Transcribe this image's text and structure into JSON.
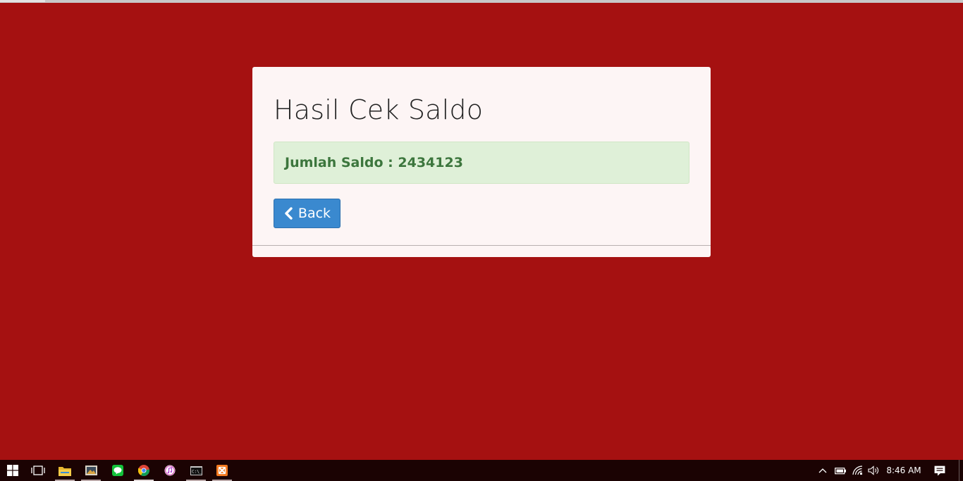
{
  "page": {
    "background_color": "#a51111"
  },
  "card": {
    "title": "Hasil Cek Saldo",
    "alert": {
      "label": "Jumlah Saldo",
      "separator": " : ",
      "value": "2434123",
      "color": "#3c763d",
      "background": "#dff0d8"
    },
    "back_button": {
      "label": "Back",
      "icon": "chevron-left-icon",
      "color": "#3a89cf"
    }
  },
  "taskbar": {
    "pinned": [
      {
        "name": "start-button",
        "icon": "windows-logo-icon"
      },
      {
        "name": "task-view-button",
        "icon": "task-view-icon"
      },
      {
        "name": "file-explorer",
        "icon": "folder-icon",
        "running": true
      },
      {
        "name": "image-viewer",
        "icon": "picture-icon",
        "running": true
      },
      {
        "name": "line-messenger",
        "icon": "chat-bubble-icon"
      },
      {
        "name": "chrome-browser",
        "icon": "chrome-icon",
        "running": true,
        "active": true
      },
      {
        "name": "itunes",
        "icon": "music-note-icon"
      },
      {
        "name": "command-prompt",
        "icon": "terminal-icon",
        "running": true
      },
      {
        "name": "xampp",
        "icon": "xampp-icon",
        "running": true
      }
    ],
    "tray": {
      "icons": [
        "chevron-up-icon",
        "battery-icon",
        "wifi-icon",
        "volume-icon"
      ],
      "clock": "8:46 AM",
      "notification_icon": "action-center-icon"
    }
  }
}
